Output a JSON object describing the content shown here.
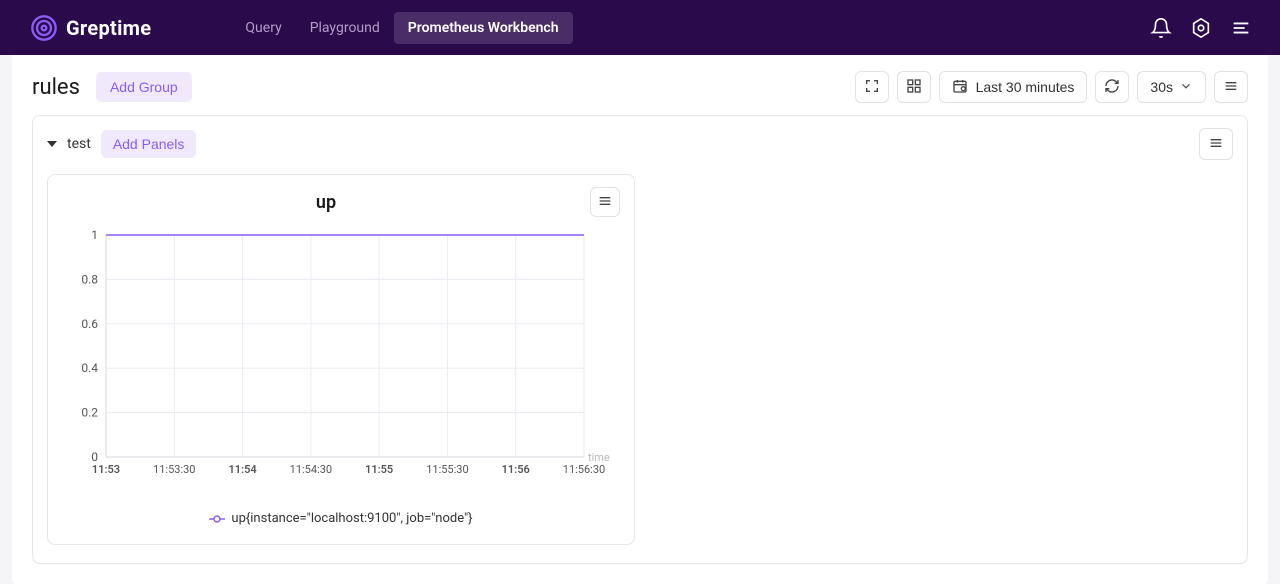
{
  "brand": {
    "name": "Greptime"
  },
  "nav": {
    "items": [
      {
        "label": "Query",
        "active": false
      },
      {
        "label": "Playground",
        "active": false
      },
      {
        "label": "Prometheus Workbench",
        "active": true
      }
    ]
  },
  "page": {
    "title": "rules",
    "add_group_label": "Add Group"
  },
  "toolbar": {
    "time_range": "Last 30 minutes",
    "refresh_interval": "30s"
  },
  "group": {
    "name": "test",
    "add_panels_label": "Add Panels"
  },
  "panel": {
    "title": "up",
    "axis_label": "time",
    "legend_label": "up{instance=\"localhost:9100\", job=\"node\"}"
  },
  "chart_data": {
    "type": "line",
    "title": "up",
    "xlabel": "time",
    "ylabel": "",
    "ylim": [
      0,
      1
    ],
    "y_ticks": [
      0,
      0.2,
      0.4,
      0.6,
      0.8,
      1
    ],
    "x_ticks": [
      "11:53",
      "11:53:30",
      "11:54",
      "11:54:30",
      "11:55",
      "11:55:30",
      "11:56",
      "11:56:30"
    ],
    "series": [
      {
        "name": "up{instance=\"localhost:9100\", job=\"node\"}",
        "color": "#8b5cf6",
        "values": [
          1,
          1,
          1,
          1,
          1,
          1,
          1,
          1
        ]
      }
    ]
  }
}
